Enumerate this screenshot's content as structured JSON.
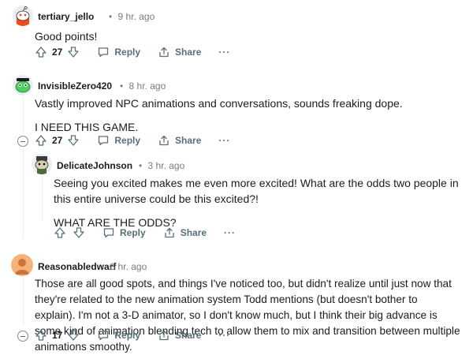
{
  "comments": [
    {
      "username": "tertiary_jello",
      "time": "9 hr. ago",
      "paragraphs": [
        "Good points!"
      ],
      "votes": "27",
      "reply_label": "Reply",
      "share_label": "Share",
      "more_label": "···",
      "avatar_color": "#ef4b1c"
    },
    {
      "username": "InvisibleZero420",
      "time": "8 hr. ago",
      "paragraphs": [
        "Vastly improved NPC animations and conversations, sounds freaking dope.",
        "I NEED THIS GAME."
      ],
      "votes": "27",
      "reply_label": "Reply",
      "share_label": "Share",
      "more_label": "···",
      "avatar_color": "#46d160"
    },
    {
      "username": "DelicateJohnson",
      "time": "3 hr. ago",
      "paragraphs": [
        "Seeing you excited makes me even more excited! What are the odds two people in this entire universe could be this excited?!",
        "WHAT ARE THE ODDS?"
      ],
      "votes": "",
      "reply_label": "Reply",
      "share_label": "Share",
      "more_label": "···",
      "avatar_color": "#3b3b3b"
    },
    {
      "username": "Reasonabledwarf",
      "time": "8 hr. ago",
      "paragraphs": [
        "Those are all good spots, and things I've noticed too, but didn't realize until just now that they're related to the new animation system Todd mentions (but doesn't bother to explain). I'm not a 3-D animator, so I don't know much, but I think their big advance is some kind of animation blending tech to allow them to mix and transition between multiple animations smoothy."
      ],
      "votes": "17",
      "reply_label": "Reply",
      "share_label": "Share",
      "more_label": "···",
      "avatar_color": "#f5b27a"
    }
  ],
  "separator": "•",
  "colors": {
    "meta": "#7c7c7c",
    "action": "#576f76",
    "thread_line": "#edeff1"
  }
}
